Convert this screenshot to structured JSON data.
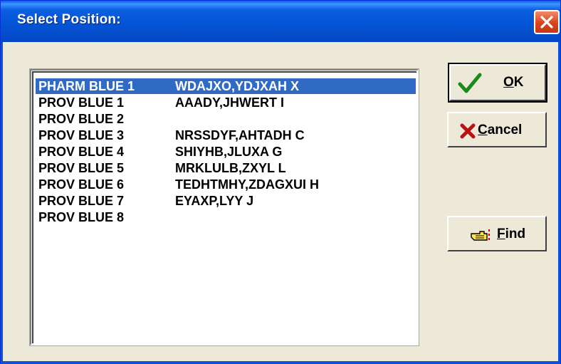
{
  "window": {
    "title": "Select Position:"
  },
  "list": {
    "rows": [
      {
        "position": "PHARM BLUE 1",
        "name": "WDAJXO,YDJXAH X",
        "selected": true
      },
      {
        "position": "PROV BLUE 1",
        "name": "AAADY,JHWERT I"
      },
      {
        "position": "PROV BLUE 2",
        "name": ""
      },
      {
        "position": "PROV BLUE 3",
        "name": "NRSSDYF,AHTADH C"
      },
      {
        "position": "PROV BLUE 4",
        "name": "SHIYHB,JLUXA G"
      },
      {
        "position": "PROV BLUE 5",
        "name": "MRKLULB,ZXYL L"
      },
      {
        "position": "PROV BLUE 6",
        "name": "TEDHTMHY,ZDAGXUI H"
      },
      {
        "position": "PROV BLUE 7",
        "name": "EYAXP,LYY J"
      },
      {
        "position": "PROV BLUE 8",
        "name": ""
      }
    ]
  },
  "buttons": {
    "ok": {
      "label_ul": "O",
      "label_rest": "K",
      "icon": "checkmark-icon"
    },
    "cancel": {
      "label_ul": "C",
      "label_rest": "ancel",
      "icon": "red-x-icon"
    },
    "find": {
      "label_ul": "F",
      "label_rest": "ind",
      "icon": "pointing-hand-icon"
    }
  },
  "colors": {
    "title_bar": "#0453d4",
    "selection": "#316ac5",
    "dialog_bg": "#ece9d8",
    "close_button": "#d8431c"
  }
}
